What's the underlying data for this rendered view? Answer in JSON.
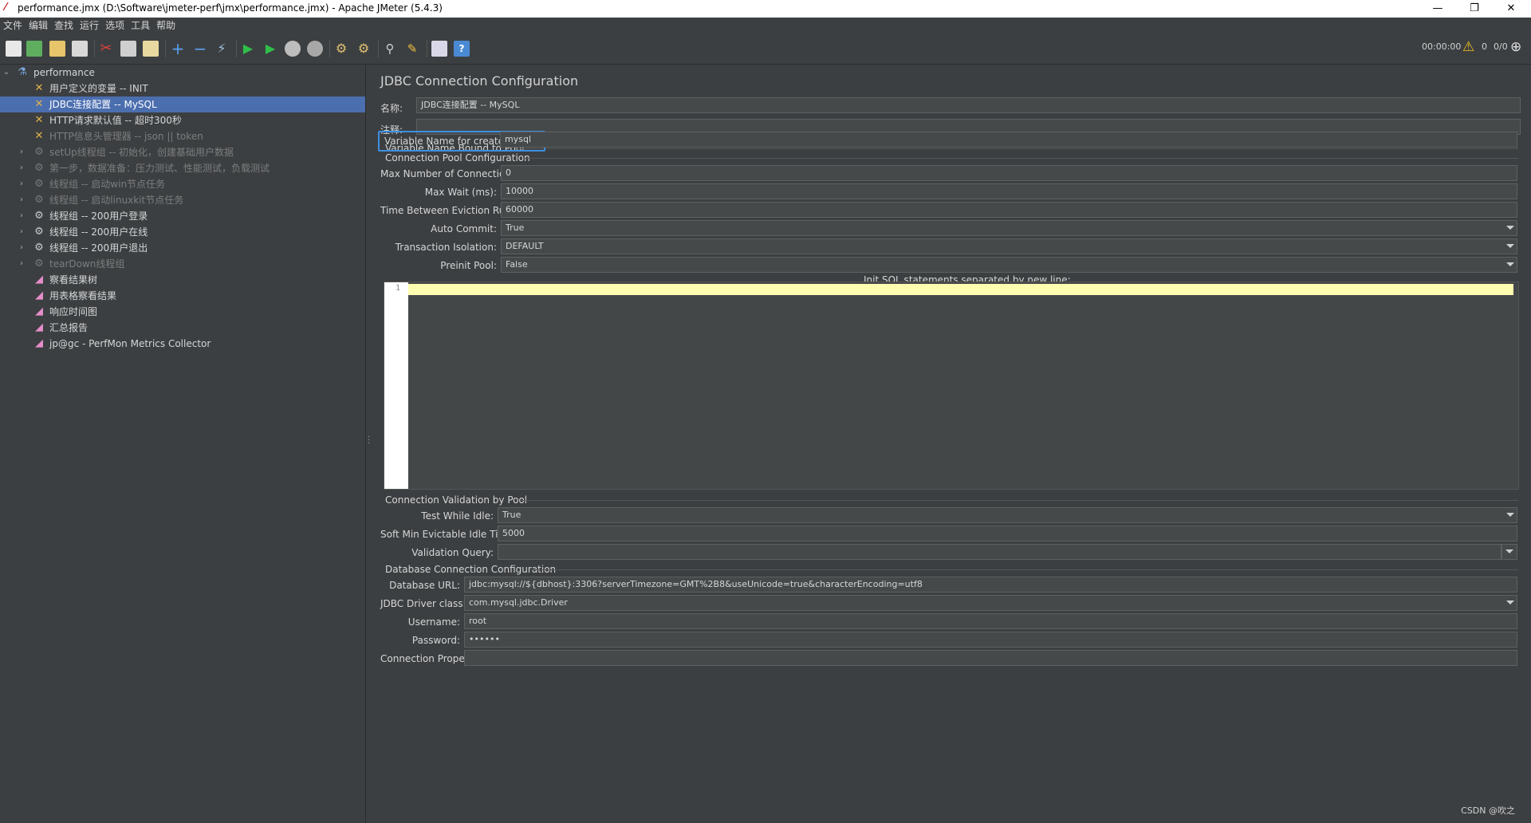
{
  "window": {
    "title": "performance.jmx (D:\\Software\\jmeter-perf\\jmx\\performance.jmx) - Apache JMeter (5.4.3)",
    "minimize": "—",
    "restore": "❐",
    "close": "✕"
  },
  "menu": [
    "文件",
    "编辑",
    "查找",
    "运行",
    "选项",
    "工具",
    "帮助"
  ],
  "toolbar": {
    "timer": "00:00:00",
    "warning_count": "0",
    "thread_ratio": "0/0",
    "icons": [
      "new-icon",
      "templates-icon",
      "open-icon",
      "save-icon",
      "cut-icon",
      "copy-icon",
      "paste-icon",
      "expand-icon",
      "collapse-icon",
      "toggle-icon",
      "start-icon",
      "start-no-pause-icon",
      "stop-icon",
      "shutdown-icon",
      "clear-icon",
      "clear-all-icon",
      "search-icon",
      "reset-search-icon",
      "function-helper-icon",
      "help-icon"
    ]
  },
  "tree": {
    "root": "performance",
    "items": [
      {
        "label": "用户定义的变量 -- INIT",
        "icon": "config-icon",
        "disabled": false,
        "selected": false,
        "expandable": false
      },
      {
        "label": "JDBC连接配置 -- MySQL",
        "icon": "config-icon",
        "disabled": false,
        "selected": true,
        "expandable": false
      },
      {
        "label": "HTTP请求默认值 -- 超时300秒",
        "icon": "config-icon",
        "disabled": false,
        "selected": false,
        "expandable": false
      },
      {
        "label": "HTTP信息头管理器 -- json || token",
        "icon": "config-icon",
        "disabled": true,
        "selected": false,
        "expandable": false
      },
      {
        "label": "setUp线程组 -- 初始化，创建基础用户数据",
        "icon": "gear-icon",
        "disabled": true,
        "selected": false,
        "expandable": true
      },
      {
        "label": "第一步，数据准备：压力测试、性能测试，负载测试",
        "icon": "gear-icon",
        "disabled": true,
        "selected": false,
        "expandable": true
      },
      {
        "label": "线程组 -- 启动win节点任务",
        "icon": "gear-icon",
        "disabled": true,
        "selected": false,
        "expandable": true
      },
      {
        "label": "线程组 -- 启动linuxkit节点任务",
        "icon": "gear-icon",
        "disabled": true,
        "selected": false,
        "expandable": true
      },
      {
        "label": "线程组 -- 200用户登录",
        "icon": "gear-icon",
        "disabled": false,
        "selected": false,
        "expandable": true
      },
      {
        "label": "线程组 -- 200用户在线",
        "icon": "gear-icon",
        "disabled": false,
        "selected": false,
        "expandable": true
      },
      {
        "label": "线程组 -- 200用户退出",
        "icon": "gear-icon",
        "disabled": false,
        "selected": false,
        "expandable": true
      },
      {
        "label": "tearDown线程组",
        "icon": "gear-icon",
        "disabled": true,
        "selected": false,
        "expandable": true
      },
      {
        "label": "察看结果树",
        "icon": "listener-icon",
        "disabled": false,
        "selected": false,
        "expandable": false
      },
      {
        "label": "用表格察看结果",
        "icon": "listener-icon",
        "disabled": false,
        "selected": false,
        "expandable": false
      },
      {
        "label": "响应时间图",
        "icon": "listener-icon",
        "disabled": false,
        "selected": false,
        "expandable": false
      },
      {
        "label": "汇总报告",
        "icon": "listener-icon",
        "disabled": false,
        "selected": false,
        "expandable": false
      },
      {
        "label": "jp@gc - PerfMon Metrics Collector",
        "icon": "listener-icon",
        "disabled": false,
        "selected": false,
        "expandable": false
      }
    ]
  },
  "panel": {
    "title": "JDBC Connection Configuration",
    "name_label": "名称:",
    "name_value": "JDBC连接配置 -- MySQL",
    "comment_label": "注释:",
    "comment_value": "",
    "pool_section": "Variable Name Bound to Pool",
    "pool_var_label": "Variable Name for created pool:",
    "pool_var_value": "mysql",
    "conn_pool_section": "Connection Pool Configuration",
    "max_conn_label": "Max Number of Connections:",
    "max_conn_value": "0",
    "max_wait_label": "Max Wait (ms):",
    "max_wait_value": "10000",
    "eviction_label": "Time Between Eviction Runs (ms):",
    "eviction_value": "60000",
    "auto_commit_label": "Auto Commit:",
    "auto_commit_value": "True",
    "isolation_label": "Transaction Isolation:",
    "isolation_value": "DEFAULT",
    "preinit_label": "Preinit Pool:",
    "preinit_value": "False",
    "init_sql_label": "Init SQL statements separated by new line:",
    "init_sql_line": "1",
    "validation_section": "Connection Validation by Pool",
    "test_idle_label": "Test While Idle:",
    "test_idle_value": "True",
    "soft_min_label": "Soft Min Evictable Idle Time(ms):",
    "soft_min_value": "5000",
    "validation_query_label": "Validation Query:",
    "validation_query_value": "",
    "db_section": "Database Connection Configuration",
    "db_url_label": "Database URL:",
    "db_url_value": "jdbc:mysql://${dbhost}:3306?serverTimezone=GMT%2B8&useUnicode=true&characterEncoding=utf8",
    "driver_label": "JDBC Driver class:",
    "driver_value": "com.mysql.jdbc.Driver",
    "username_label": "Username:",
    "username_value": "root",
    "password_label": "Password:",
    "password_value": "••••••",
    "props_label": "Connection Properties:",
    "props_value": ""
  },
  "watermark": "CSDN @吹之"
}
